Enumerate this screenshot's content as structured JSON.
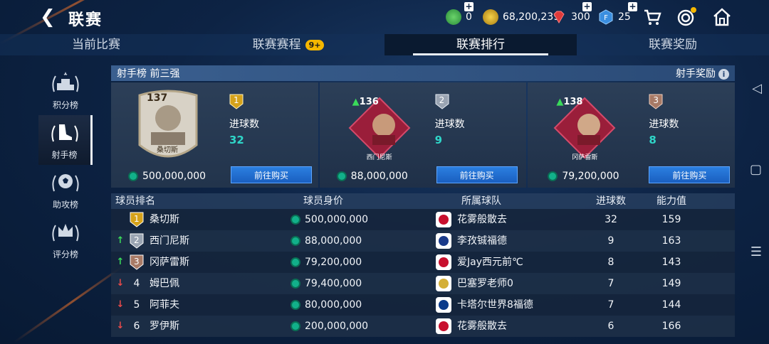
{
  "header": {
    "back_label": "❮",
    "title": "联赛",
    "currencies": [
      {
        "name": "green-points",
        "value": "0",
        "color": "#3aa84a"
      },
      {
        "name": "coins",
        "value": "68,200,239",
        "color": "#d6a21a"
      },
      {
        "name": "gems",
        "value": "300",
        "color": "#e03a3a"
      },
      {
        "name": "fc-points",
        "value": "25",
        "color": "#3a8ee0"
      }
    ]
  },
  "tabs": [
    {
      "label": "当前比赛",
      "badge": ""
    },
    {
      "label": "联赛赛程",
      "badge": "9+"
    },
    {
      "label": "联赛排行",
      "badge": ""
    },
    {
      "label": "联赛奖励",
      "badge": ""
    }
  ],
  "side": [
    {
      "label": "积分榜"
    },
    {
      "label": "射手榜"
    },
    {
      "label": "助攻榜"
    },
    {
      "label": "评分榜"
    }
  ],
  "panel": {
    "title": "射手榜 前三强",
    "reward_label": "射手奖励",
    "goals_label": "进球数",
    "buy_label": "前往购买",
    "top3": [
      {
        "rank": "1",
        "rating": "137",
        "name": "桑切斯",
        "goals": "32",
        "price": "500,000,000"
      },
      {
        "rank": "2",
        "rating": "136",
        "name": "西门尼斯",
        "goals": "9",
        "price": "88,000,000"
      },
      {
        "rank": "3",
        "rating": "138",
        "name": "冈萨雷斯",
        "goals": "8",
        "price": "79,200,000"
      }
    ],
    "table_headers": [
      "球员排名",
      "球员身价",
      "所属球队",
      "进球数",
      "能力值"
    ],
    "rows": [
      {
        "trend": "",
        "rank": "1",
        "name": "桑切斯",
        "price": "500,000,000",
        "team": "花雾般散去",
        "goals": "32",
        "ovr": "159"
      },
      {
        "trend": "up",
        "rank": "2",
        "name": "西门尼斯",
        "price": "88,000,000",
        "team": "李孜铖福德",
        "goals": "9",
        "ovr": "163"
      },
      {
        "trend": "up",
        "rank": "3",
        "name": "冈萨雷斯",
        "price": "79,200,000",
        "team": "爱Jay西元前℃",
        "goals": "8",
        "ovr": "143"
      },
      {
        "trend": "down",
        "rank": "4",
        "name": "姆巴佩",
        "price": "79,400,000",
        "team": "巴塞罗老师0",
        "goals": "7",
        "ovr": "149"
      },
      {
        "trend": "down",
        "rank": "5",
        "name": "阿菲夫",
        "price": "80,000,000",
        "team": "卡塔尔世界8福德",
        "goals": "7",
        "ovr": "144"
      },
      {
        "trend": "down",
        "rank": "6",
        "name": "罗伊斯",
        "price": "200,000,000",
        "team": "花雾般散去",
        "goals": "6",
        "ovr": "166"
      }
    ]
  }
}
